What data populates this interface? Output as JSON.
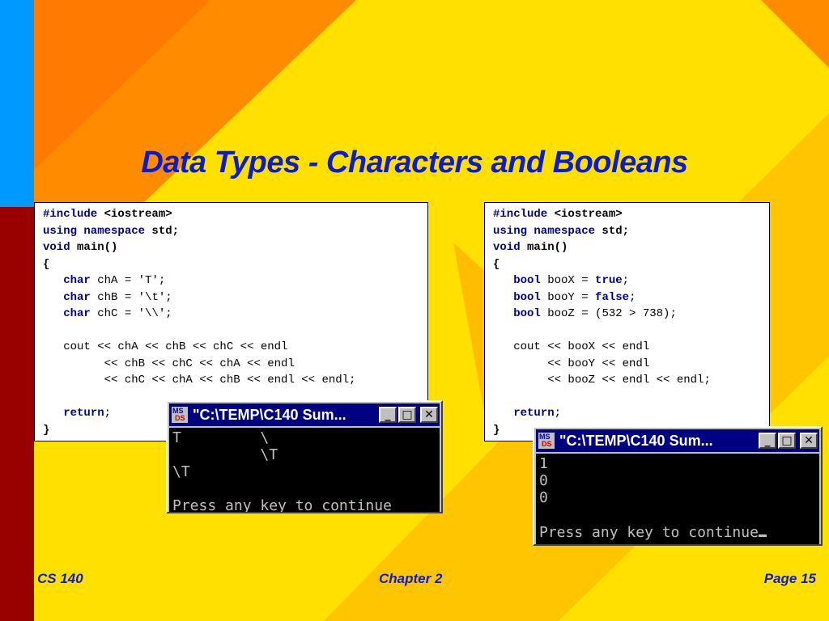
{
  "slide": {
    "title": "Data Types - Characters and Booleans",
    "colors": {
      "title": "#0a1ccf",
      "background": "#ffe000",
      "accent_orange": "#ff8c00",
      "side_blue": "#0099ff",
      "side_red": "#990000"
    }
  },
  "code_left": {
    "lines": [
      [
        {
          "t": "#include",
          "c": "pp"
        },
        {
          "t": " <iostream>",
          "c": "bl"
        }
      ],
      [
        {
          "t": "using namespace",
          "c": "kw"
        },
        {
          "t": " std;",
          "c": "bl"
        }
      ],
      [
        {
          "t": "void",
          "c": "kw"
        },
        {
          "t": " main()",
          "c": "bl"
        }
      ],
      [
        {
          "t": "{",
          "c": "bl"
        }
      ],
      [
        {
          "t": "   "
        },
        {
          "t": "char",
          "c": "kw"
        },
        {
          "t": " chA = 'T';"
        }
      ],
      [
        {
          "t": "   "
        },
        {
          "t": "char",
          "c": "kw"
        },
        {
          "t": " chB = '\\t';"
        }
      ],
      [
        {
          "t": "   "
        },
        {
          "t": "char",
          "c": "kw"
        },
        {
          "t": " chC = '\\\\';"
        }
      ],
      [
        {
          "t": ""
        }
      ],
      [
        {
          "t": "   cout << chA << chB << chC << endl"
        }
      ],
      [
        {
          "t": "         << chB << chC << chA << endl"
        }
      ],
      [
        {
          "t": "         << chC << chA << chB << endl << endl;"
        }
      ],
      [
        {
          "t": ""
        }
      ],
      [
        {
          "t": "   "
        },
        {
          "t": "return",
          "c": "kw"
        },
        {
          "t": ";"
        }
      ],
      [
        {
          "t": "}",
          "c": "bl"
        }
      ]
    ]
  },
  "code_right": {
    "lines": [
      [
        {
          "t": "#include",
          "c": "pp"
        },
        {
          "t": " <iostream>",
          "c": "bl"
        }
      ],
      [
        {
          "t": "using namespace",
          "c": "kw"
        },
        {
          "t": " std;",
          "c": "bl"
        }
      ],
      [
        {
          "t": "void",
          "c": "kw"
        },
        {
          "t": " main()",
          "c": "bl"
        }
      ],
      [
        {
          "t": "{",
          "c": "bl"
        }
      ],
      [
        {
          "t": "   "
        },
        {
          "t": "bool",
          "c": "kw"
        },
        {
          "t": " booX = "
        },
        {
          "t": "true",
          "c": "kw"
        },
        {
          "t": ";"
        }
      ],
      [
        {
          "t": "   "
        },
        {
          "t": "bool",
          "c": "kw"
        },
        {
          "t": " booY = "
        },
        {
          "t": "false",
          "c": "kw"
        },
        {
          "t": ";"
        }
      ],
      [
        {
          "t": "   "
        },
        {
          "t": "bool",
          "c": "kw"
        },
        {
          "t": " booZ = (532 > 738);"
        }
      ],
      [
        {
          "t": ""
        }
      ],
      [
        {
          "t": "   cout << booX << endl"
        }
      ],
      [
        {
          "t": "        << booY << endl"
        }
      ],
      [
        {
          "t": "        << booZ << endl << endl;"
        }
      ],
      [
        {
          "t": ""
        }
      ],
      [
        {
          "t": "   "
        },
        {
          "t": "return",
          "c": "kw"
        },
        {
          "t": ";"
        }
      ],
      [
        {
          "t": "}",
          "c": "bl"
        }
      ]
    ]
  },
  "console_1": {
    "title": "\"C:\\TEMP\\C140 Sum...",
    "icon_top": "MS",
    "icon_bottom": "DS",
    "output": "T         \\\n          \\T\n\\T\n\nPress any key to continue",
    "min_label": "_",
    "max_label": "□",
    "close_label": "✕"
  },
  "console_2": {
    "title": "\"C:\\TEMP\\C140 Sum...",
    "icon_top": "MS",
    "icon_bottom": "DS",
    "output": "1\n0\n0\n\nPress any key to continue",
    "min_label": "_",
    "max_label": "□",
    "close_label": "✕"
  },
  "footer": {
    "left": "CS 140",
    "center": "Chapter 2",
    "right": "Page 15"
  }
}
